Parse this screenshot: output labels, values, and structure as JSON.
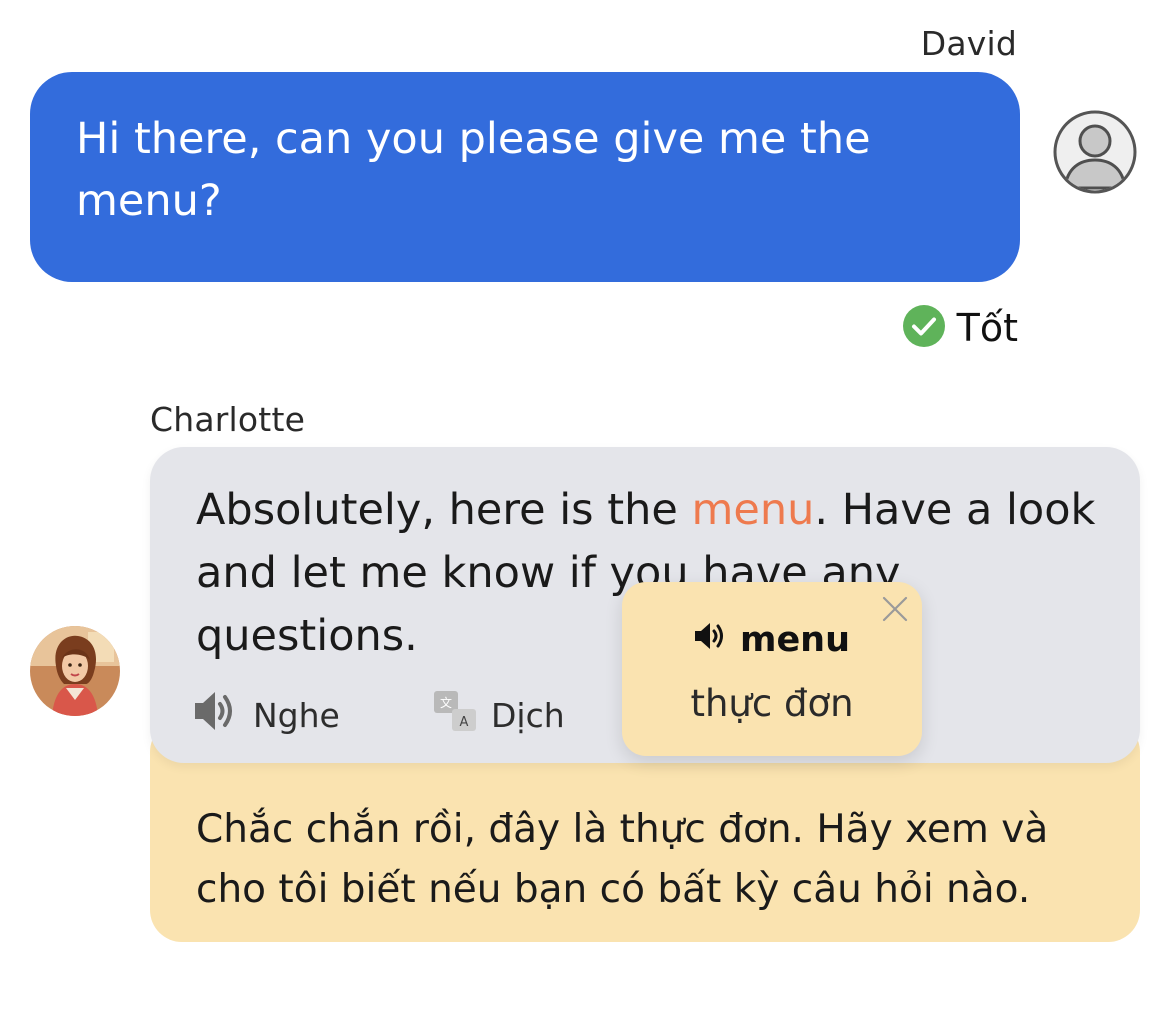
{
  "user_message": {
    "sender": "David",
    "text": "Hi there, can you please give me the menu?",
    "feedback": {
      "label": "Tốt",
      "icon": "check-circle-icon",
      "color": "#5fb35a"
    }
  },
  "bot_message": {
    "sender": "Charlotte",
    "text_before": "Absolutely, here is the ",
    "highlight_word": "menu",
    "text_after": ". Have a look and let me know if you have any questions.",
    "actions": {
      "listen_label": "Nghe",
      "translate_label": "Dịch"
    },
    "translation": "Chắc chắn rồi, đây là thực đơn. Hãy xem và cho tôi biết nếu bạn có bất kỳ câu hỏi nào."
  },
  "word_popup": {
    "word": "menu",
    "meaning": "thực đơn"
  },
  "colors": {
    "user_bubble": "#336cdc",
    "bot_bubble": "#e4e5ea",
    "translation_bg": "#fae3b0",
    "highlight": "#ee7a4e"
  }
}
